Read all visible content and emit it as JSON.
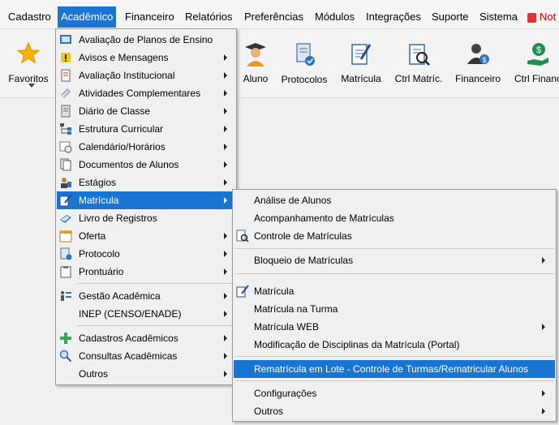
{
  "menubar": {
    "items": [
      "Cadastro",
      "Acadêmico",
      "Financeiro",
      "Relatórios",
      "Preferências",
      "Módulos",
      "Integrações",
      "Suporte",
      "Sistema"
    ],
    "notification_label": "Not"
  },
  "toolbar": {
    "favorites": "Favoritos",
    "aluno": "Aluno",
    "protocolos": "Protocolos",
    "matricula": "Matrícula",
    "ctrl_matric": "Ctrl Matríc.",
    "financeiro": "Financeiro",
    "ctrl_financ": "Ctrl Financ"
  },
  "academico_menu": {
    "items": [
      "Avaliação de Planos de Ensino",
      "Avisos e Mensagens",
      "Avaliação Institucional",
      "Atividades Complementares",
      "Diário de Classe",
      "Estrutura Curricular",
      "Calendário/Horários",
      "Documentos de Alunos",
      "Estágios",
      "Matrícula",
      "Livro de Registros",
      "Oferta",
      "Protocolo",
      "Prontuário",
      "Gestão Acadêmica",
      "INEP (CENSO/ENADE)",
      "Cadastros Acadêmicos",
      "Consultas Acadêmicas",
      "Outros"
    ]
  },
  "matricula_submenu": {
    "items": [
      "Análise de Alunos",
      "Acompanhamento de Matrículas",
      "Controle de Matrículas",
      "Bloqueio de Matrículas",
      "Matrícula",
      "Matrícula na Turma",
      "Matrícula WEB",
      "Modificação de Disciplinas da Matrícula (Portal)",
      "Rematrícula em Lote - Controle de Turmas/Rematricular Alunos",
      "Configurações",
      "Outros"
    ]
  },
  "colors": {
    "accent": "#1a75d2",
    "menu_bg": "#f0f0f0"
  }
}
